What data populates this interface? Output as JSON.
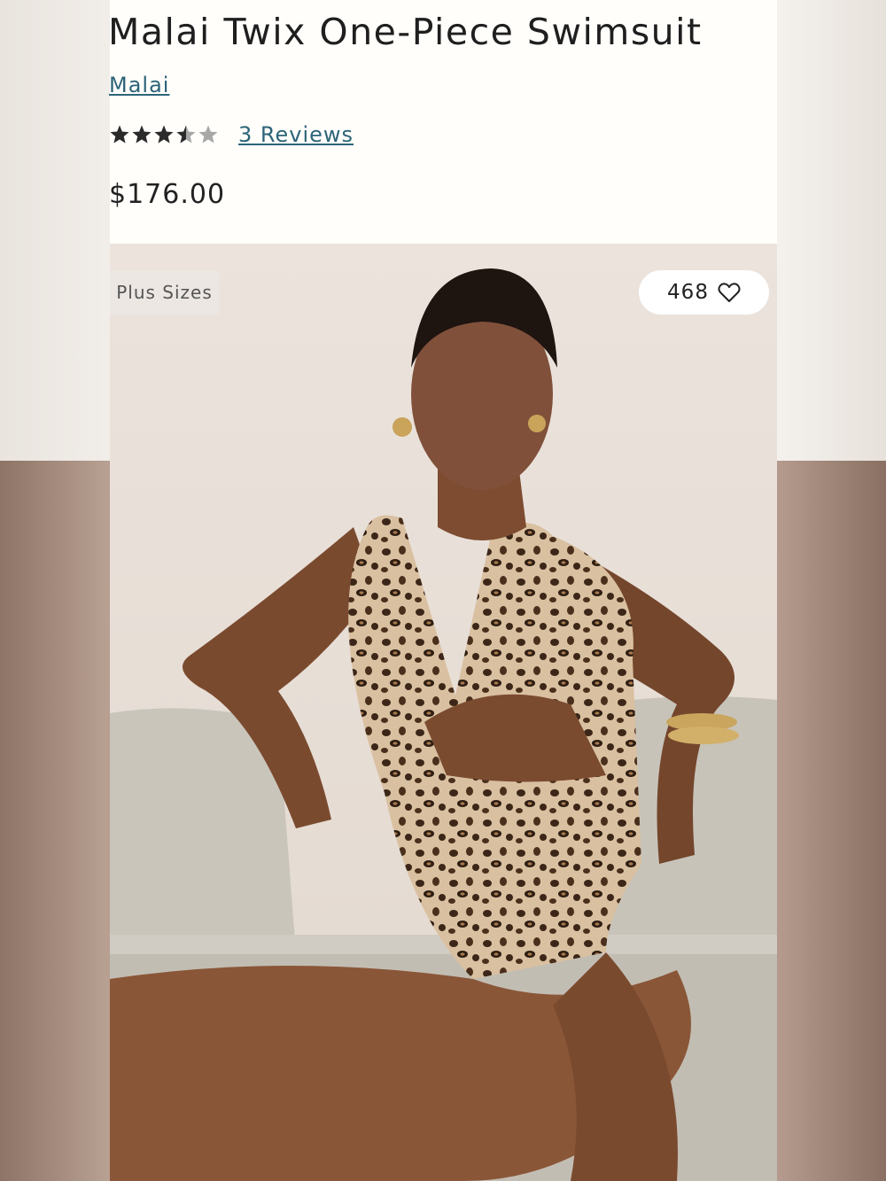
{
  "product": {
    "title": "Malai Twix One-Piece Swimsuit",
    "brand": "Malai",
    "rating": 3.5,
    "rating_max": 5,
    "reviews_label": "3 Reviews",
    "price": "$176.00"
  },
  "image": {
    "tag": "Plus Sizes",
    "favorites_count": "468",
    "favorite_icon": "heart-outline-icon"
  },
  "colors": {
    "link": "#2c6478",
    "star_filled": "#2b2b2b",
    "star_empty": "#a8a8a8"
  }
}
